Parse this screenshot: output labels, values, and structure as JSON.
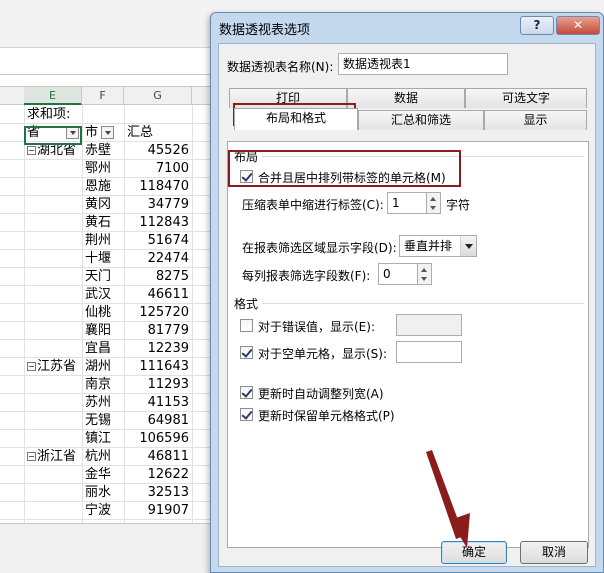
{
  "spreadsheet": {
    "columns": [
      "F",
      "F",
      "G"
    ],
    "header_row": {
      "label": "求和项:"
    },
    "field_row": {
      "province": "省",
      "city": "市",
      "total": "汇总"
    },
    "rows": [
      {
        "province": "湖北省",
        "city": "赤壁",
        "value": "45526"
      },
      {
        "province": "",
        "city": "鄂州",
        "value": "7100"
      },
      {
        "province": "",
        "city": "恩施",
        "value": "118470"
      },
      {
        "province": "",
        "city": "黄冈",
        "value": "34779"
      },
      {
        "province": "",
        "city": "黄石",
        "value": "112843"
      },
      {
        "province": "",
        "city": "荆州",
        "value": "51674"
      },
      {
        "province": "",
        "city": "十堰",
        "value": "22474"
      },
      {
        "province": "",
        "city": "天门",
        "value": "8275"
      },
      {
        "province": "",
        "city": "武汉",
        "value": "46611"
      },
      {
        "province": "",
        "city": "仙桃",
        "value": "125720"
      },
      {
        "province": "",
        "city": "襄阳",
        "value": "81779"
      },
      {
        "province": "",
        "city": "宜昌",
        "value": "12239"
      },
      {
        "province": "江苏省",
        "city": "湖州",
        "value": "111643"
      },
      {
        "province": "",
        "city": "南京",
        "value": "11293"
      },
      {
        "province": "",
        "city": "苏州",
        "value": "41153"
      },
      {
        "province": "",
        "city": "无锡",
        "value": "64981"
      },
      {
        "province": "",
        "city": "镇江",
        "value": "106596"
      },
      {
        "province": "浙江省",
        "city": "杭州",
        "value": "46811"
      },
      {
        "province": "",
        "city": "金华",
        "value": "12622"
      },
      {
        "province": "",
        "city": "丽水",
        "value": "32513"
      },
      {
        "province": "",
        "city": "宁波",
        "value": "91907"
      }
    ]
  },
  "dialog": {
    "title": "数据透视表选项",
    "help_label": "?",
    "close_label": "✕",
    "name_label": "数据透视表名称(N):",
    "name_value": "数据透视表1",
    "tabs_row1": [
      "打印",
      "数据",
      "可选文字"
    ],
    "tabs_row2": [
      "布局和格式",
      "汇总和筛选",
      "显示"
    ],
    "active_tab": "布局和格式",
    "layout": {
      "section": "布局",
      "merge_center_label": "合并且居中排列带标签的单元格(M)",
      "merge_center_checked": true,
      "indent_label": "压缩表单中缩进行标签(C):",
      "indent_value": "1",
      "indent_unit": "字符",
      "filter_order_label": "在报表筛选区域显示字段(D):",
      "filter_order_value": "垂直并排",
      "filter_count_label": "每列报表筛选字段数(F):",
      "filter_count_value": "0"
    },
    "format": {
      "section": "格式",
      "error_label": "对于错误值，显示(E):",
      "error_checked": false,
      "empty_label": "对于空单元格，显示(S):",
      "empty_checked": true,
      "autofit_label": "更新时自动调整列宽(A)",
      "autofit_checked": true,
      "preserve_label": "更新时保留单元格格式(P)",
      "preserve_checked": true
    },
    "ok_label": "确定",
    "cancel_label": "取消"
  },
  "annotation_color": "#8b1c1c"
}
